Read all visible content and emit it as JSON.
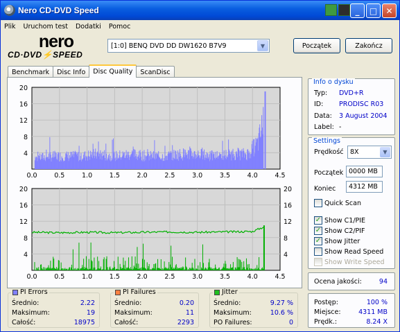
{
  "window": {
    "title": "Nero CD-DVD Speed"
  },
  "menu": [
    "Plik",
    "Uruchom test",
    "Dodatki",
    "Pomoc"
  ],
  "logo": {
    "brand": "nero",
    "sub": "CD·DVD⚡SPEED"
  },
  "drive": {
    "selected": "[1:0]  BENQ DVD DD DW1620 B7V9"
  },
  "buttons": {
    "start": "Początek",
    "exit": "Zakończ"
  },
  "tabs": [
    "Benchmark",
    "Disc Info",
    "Disc Quality",
    "ScanDisc"
  ],
  "active_tab": "Disc Quality",
  "chart_data": [
    {
      "type": "bar",
      "title": "",
      "x_ticks": [
        "0.0",
        "0.5",
        "1.0",
        "1.5",
        "2.0",
        "2.5",
        "3.0",
        "3.5",
        "4.0",
        "4.5"
      ],
      "y_ticks": [
        "4",
        "8",
        "12",
        "16",
        "20"
      ],
      "xlim": [
        0,
        4.5
      ],
      "ylim": [
        0,
        20
      ],
      "series": [
        {
          "name": "PI Errors",
          "color": "#8080ff",
          "x": [
            0.05,
            0.3,
            0.6,
            0.9,
            1.2,
            1.5,
            1.8,
            2.1,
            2.4,
            2.7,
            3.0,
            3.3,
            3.6,
            3.9,
            4.1,
            4.18,
            4.22
          ],
          "values": [
            2.5,
            3,
            3,
            3,
            3.5,
            3,
            3.5,
            3,
            3,
            3.5,
            3.5,
            3,
            3.5,
            3.5,
            6,
            10,
            19
          ]
        }
      ]
    },
    {
      "type": "line",
      "title": "",
      "x_ticks": [
        "0.0",
        "0.5",
        "1.0",
        "1.5",
        "2.0",
        "2.5",
        "3.0",
        "3.5",
        "4.0",
        "4.5"
      ],
      "y_ticks_left": [
        "4",
        "8",
        "12",
        "16",
        "20"
      ],
      "y_ticks_right": [
        "4",
        "8",
        "12",
        "16",
        "20"
      ],
      "xlim": [
        0,
        4.5
      ],
      "ylim": [
        0,
        20
      ],
      "series": [
        {
          "name": "PI Failures",
          "color": "#00b000",
          "x": [
            0.1,
            0.5,
            0.9,
            1.3,
            1.7,
            2.1,
            2.5,
            2.9,
            3.3,
            3.7,
            4.1,
            4.2
          ],
          "values": [
            1,
            1,
            1.5,
            1,
            2,
            1,
            1.5,
            1,
            2,
            2,
            5,
            11
          ]
        },
        {
          "name": "Jitter",
          "color": "#00b000",
          "x": [
            0.0,
            0.5,
            1.0,
            1.5,
            2.0,
            2.5,
            3.0,
            3.5,
            4.0,
            4.2
          ],
          "values": [
            9.3,
            9.2,
            9.3,
            9.2,
            9.3,
            9.4,
            9.3,
            9.4,
            9.5,
            10.6
          ]
        }
      ]
    }
  ],
  "disc_info": {
    "title": "Info o dysku",
    "type_label": "Typ:",
    "type_value": "DVD+R",
    "id_label": "ID:",
    "id_value": "PRODISC R03",
    "date_label": "Data:",
    "date_value": "3 August 2004",
    "label_label": "Label:",
    "label_value": "-"
  },
  "settings": {
    "title": "Settings",
    "speed_label": "Prędkość",
    "speed_value": "8X",
    "start_label": "Początek",
    "start_value": "0000 MB",
    "end_label": "Koniec",
    "end_value": "4312 MB",
    "quick_scan": "Quick Scan",
    "show_c1": "Show C1/PIE",
    "show_c2": "Show C2/PIF",
    "show_jitter": "Show Jitter",
    "show_read": "Show Read Speed",
    "show_write": "Show Write Speed"
  },
  "quality": {
    "label": "Ocena jakości:",
    "value": "94"
  },
  "progress": {
    "progress_label": "Postęp:",
    "progress_value": "100 %",
    "position_label": "Miejsce:",
    "position_value": "4311 MB",
    "speed_label": "Prędk.:",
    "speed_value": "8.24 X"
  },
  "stats": {
    "pi_errors": {
      "title": "PI Errors",
      "color": "#8080ff",
      "avg_label": "Średnio:",
      "avg": "2.22",
      "max_label": "Maksimum:",
      "max": "19",
      "total_label": "Całość:",
      "total": "18975"
    },
    "pi_failures": {
      "title": "PI Failures",
      "color": "#ff8040",
      "avg_label": "Średnio:",
      "avg": "0.20",
      "max_label": "Maksimum:",
      "max": "11",
      "total_label": "Całość:",
      "total": "2293"
    },
    "jitter": {
      "title": "Jitter",
      "color": "#20c020",
      "avg_label": "Średnio:",
      "avg": "9.27 %",
      "max_label": "Maksimum:",
      "max": "10.6 %",
      "po_label": "PO Failures:",
      "po": "0"
    }
  }
}
